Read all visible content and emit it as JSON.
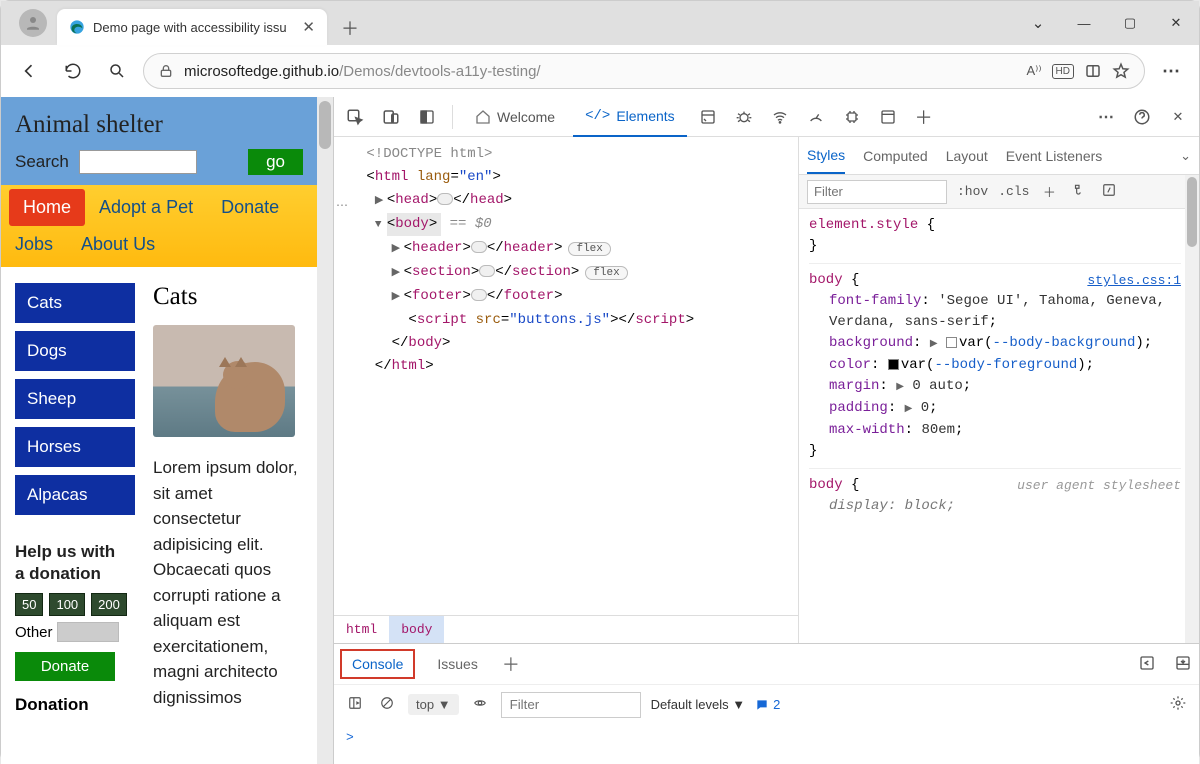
{
  "browser": {
    "tab_title": "Demo page with accessibility issu",
    "url_host": "microsoftedge.github.io",
    "url_path": "/Demos/devtools-a11y-testing/"
  },
  "page": {
    "title": "Animal shelter",
    "search_label": "Search",
    "search_button": "go",
    "nav": [
      "Home",
      "Adopt a Pet",
      "Donate",
      "Jobs",
      "About Us"
    ],
    "categories": [
      "Cats",
      "Dogs",
      "Sheep",
      "Horses",
      "Alpacas"
    ],
    "help_heading": "Help us with a donation",
    "donations": [
      "50",
      "100",
      "200"
    ],
    "other_label": "Other",
    "donate_button": "Donate",
    "donation_status": "Donation",
    "main_heading": "Cats",
    "body_text": "Lorem ipsum dolor, sit amet consectetur adipisicing elit. Obcaecati quos corrupti ratione a aliquam est exercitationem, magni architecto dignissimos"
  },
  "devtools": {
    "tabs": {
      "welcome": "Welcome",
      "elements": "Elements"
    },
    "dom": {
      "doctype": "<!DOCTYPE html>",
      "html_open": "html",
      "html_attr": "lang",
      "html_val": "\"en\"",
      "head": "head",
      "body": "body",
      "body_eq": "== $0",
      "header": "header",
      "section": "section",
      "footer": "footer",
      "script": "script",
      "script_attr": "src",
      "script_val": "\"buttons.js\"",
      "flex_pill": "flex",
      "crumbs": [
        "html",
        "body"
      ]
    },
    "styles": {
      "tabs": [
        "Styles",
        "Computed",
        "Layout",
        "Event Listeners"
      ],
      "filter_placeholder": "Filter",
      "hov": ":hov",
      "cls": ".cls",
      "rule1_sel": "element.style",
      "rule2_sel": "body",
      "rule2_link": "styles.css:1",
      "rule2_props": {
        "font_family": "'Segoe UI', Tahoma, Geneva, Verdana, sans-serif",
        "background_var": "--body-background",
        "color_var": "--body-foreground",
        "margin": "0 auto",
        "padding": "0",
        "max_width": "80em"
      },
      "rule3_sel": "body",
      "rule3_src": "user agent stylesheet",
      "rule3_display": "block"
    },
    "drawer": {
      "tabs": [
        "Console",
        "Issues"
      ],
      "top": "top",
      "filter_placeholder": "Filter",
      "levels": "Default levels",
      "issues_count": "2",
      "prompt": ">"
    }
  }
}
